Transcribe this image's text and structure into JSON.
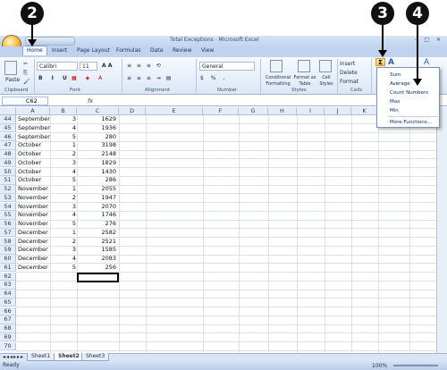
{
  "window": {
    "title": "Total Exceptions - Microsoft Excel"
  },
  "tabs": [
    "Home",
    "Insert",
    "Page Layout",
    "Formulas",
    "Data",
    "Review",
    "View"
  ],
  "ribbon": {
    "paste_label": "Paste",
    "font_name": "Calibri",
    "font_size": "11",
    "number_format": "General",
    "conditional_formatting": "Conditional Formatting",
    "format_as_table": "Format as Table",
    "cell_styles": "Cell Styles",
    "insert": "Insert",
    "delete": "Delete",
    "format": "Format",
    "groups": {
      "clipboard": "Clipboard",
      "font": "Font",
      "alignment": "Alignment",
      "number": "Number",
      "styles": "Styles",
      "cells": "Cells"
    }
  },
  "formula_bar": {
    "name_box": "C62",
    "fx": "fx",
    "formula": ""
  },
  "columns": [
    "A",
    "B",
    "C",
    "D",
    "E",
    "F",
    "G",
    "H",
    "I",
    "J",
    "K"
  ],
  "rows": [
    {
      "n": "44",
      "a": "September",
      "b": "3",
      "c": "1629"
    },
    {
      "n": "45",
      "a": "September",
      "b": "4",
      "c": "1936"
    },
    {
      "n": "46",
      "a": "September",
      "b": "5",
      "c": "280"
    },
    {
      "n": "47",
      "a": "October",
      "b": "1",
      "c": "3198"
    },
    {
      "n": "48",
      "a": "October",
      "b": "2",
      "c": "2148"
    },
    {
      "n": "49",
      "a": "October",
      "b": "3",
      "c": "1829"
    },
    {
      "n": "50",
      "a": "October",
      "b": "4",
      "c": "1430"
    },
    {
      "n": "51",
      "a": "October",
      "b": "5",
      "c": "286"
    },
    {
      "n": "52",
      "a": "November",
      "b": "1",
      "c": "2055"
    },
    {
      "n": "53",
      "a": "November",
      "b": "2",
      "c": "1947"
    },
    {
      "n": "54",
      "a": "November",
      "b": "3",
      "c": "2070"
    },
    {
      "n": "55",
      "a": "November",
      "b": "4",
      "c": "1746"
    },
    {
      "n": "56",
      "a": "November",
      "b": "5",
      "c": "276"
    },
    {
      "n": "57",
      "a": "December",
      "b": "1",
      "c": "2582"
    },
    {
      "n": "58",
      "a": "December",
      "b": "2",
      "c": "2521"
    },
    {
      "n": "59",
      "a": "December",
      "b": "3",
      "c": "1585"
    },
    {
      "n": "60",
      "a": "December",
      "b": "4",
      "c": "2083"
    },
    {
      "n": "61",
      "a": "December",
      "b": "5",
      "c": "256"
    },
    {
      "n": "62",
      "a": "",
      "b": "",
      "c": ""
    },
    {
      "n": "63",
      "a": "",
      "b": "",
      "c": ""
    },
    {
      "n": "64",
      "a": "",
      "b": "",
      "c": ""
    },
    {
      "n": "65",
      "a": "",
      "b": "",
      "c": ""
    },
    {
      "n": "66",
      "a": "",
      "b": "",
      "c": ""
    },
    {
      "n": "67",
      "a": "",
      "b": "",
      "c": ""
    },
    {
      "n": "68",
      "a": "",
      "b": "",
      "c": ""
    },
    {
      "n": "69",
      "a": "",
      "b": "",
      "c": ""
    },
    {
      "n": "70",
      "a": "",
      "b": "",
      "c": ""
    }
  ],
  "sheets": [
    "Sheet1",
    "Sheet2",
    "Sheet3"
  ],
  "status": {
    "ready": "Ready",
    "zoom": "100%"
  },
  "autosum_menu": [
    "Sum",
    "Average",
    "Count Numbers",
    "Max",
    "Min",
    "More Functions..."
  ],
  "callouts": [
    "2",
    "3",
    "4"
  ]
}
